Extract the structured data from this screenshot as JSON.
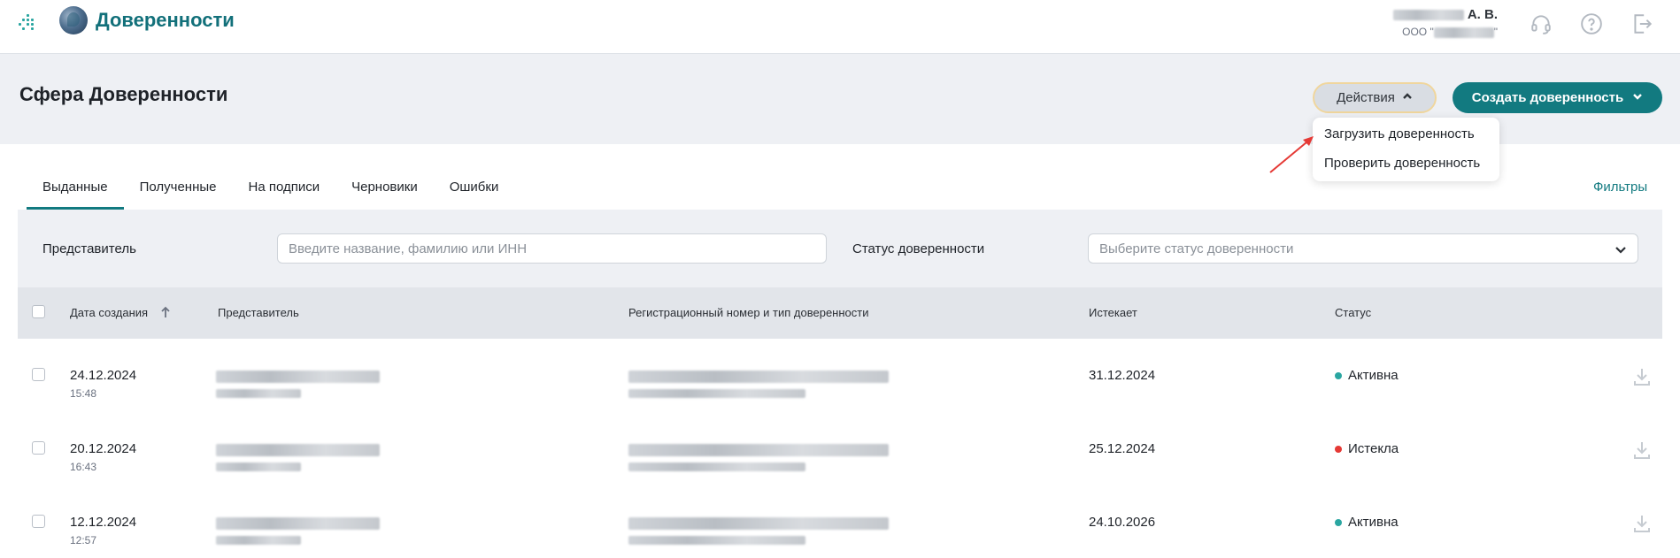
{
  "header": {
    "app_title": "Доверенности",
    "user_name": "А. В.",
    "user_org_prefix": "ООО \"",
    "user_org_suffix": "\"",
    "icons": [
      "apps-grid-icon",
      "headset-icon",
      "help-icon",
      "logout-icon"
    ]
  },
  "page": {
    "title": "Сфера Доверенности",
    "actions_label": "Действия",
    "create_label": "Создать доверенность"
  },
  "actions_menu": {
    "items": [
      "Загрузить доверенность",
      "Проверить доверенность"
    ]
  },
  "tabs": [
    {
      "label": "Выданные",
      "active": true
    },
    {
      "label": "Полученные",
      "active": false
    },
    {
      "label": "На подписи",
      "active": false
    },
    {
      "label": "Черновики",
      "active": false
    },
    {
      "label": "Ошибки",
      "active": false
    }
  ],
  "filters_link": "Фильтры",
  "filter": {
    "representative_label": "Представитель",
    "representative_placeholder": "Введите название, фамилию или ИНН",
    "status_label": "Статус доверенности",
    "status_placeholder": "Выберите статус доверенности"
  },
  "table": {
    "columns": [
      "Дата создания",
      "Представитель",
      "Регистрационный номер и тип доверенности",
      "Истекает",
      "Статус"
    ],
    "rows": [
      {
        "date": "24.12.2024",
        "time": "15:48",
        "expires": "31.12.2024",
        "status": "Активна",
        "status_color": "#2aa6a1"
      },
      {
        "date": "20.12.2024",
        "time": "16:43",
        "expires": "25.12.2024",
        "status": "Истекла",
        "status_color": "#e53935"
      },
      {
        "date": "12.12.2024",
        "time": "12:57",
        "expires": "24.10.2026",
        "status": "Активна",
        "status_color": "#2aa6a1"
      }
    ]
  },
  "colors": {
    "brand": "#127a80",
    "accent_border": "#f0d69d",
    "panel_bg": "#eef0f4",
    "annotation_arrow": "#e53935"
  }
}
